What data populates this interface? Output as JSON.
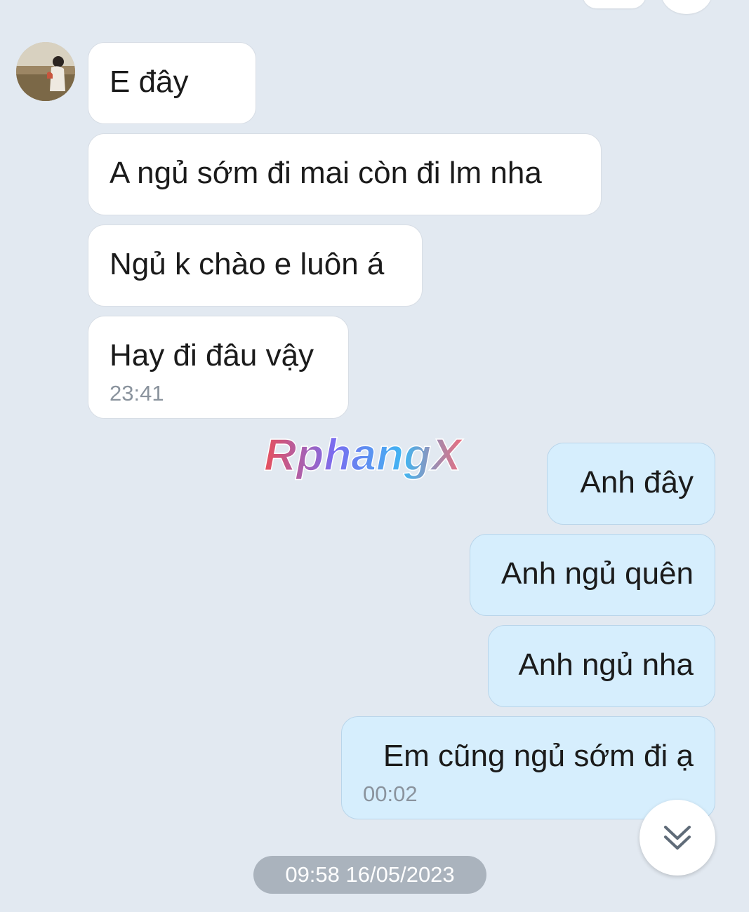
{
  "incoming": {
    "messages": [
      {
        "text": "E đây"
      },
      {
        "text": "A ngủ sớm đi mai còn đi lm nha"
      },
      {
        "text": "Ngủ k chào e luôn á"
      },
      {
        "text": "Hay đi đâu vậy",
        "time": "23:41"
      }
    ]
  },
  "outgoing": {
    "messages": [
      {
        "text": "Anh đây"
      },
      {
        "text": "Anh ngủ quên"
      },
      {
        "text": "Anh ngủ nha"
      },
      {
        "text": "Em cũng ngủ sớm đi ạ",
        "time": "00:02"
      }
    ]
  },
  "watermark": {
    "text": "RphangX"
  },
  "date_separator": "09:58 16/05/2023",
  "icons": {
    "contact_avatar": "avatar",
    "scroll_down": "double-chevron-down-icon"
  },
  "colors": {
    "background": "#e2e9f1",
    "incoming_bubble": "#ffffff",
    "outgoing_bubble": "#d6eefd",
    "timestamp": "#8a939d",
    "date_pill": "#aab3bd"
  }
}
